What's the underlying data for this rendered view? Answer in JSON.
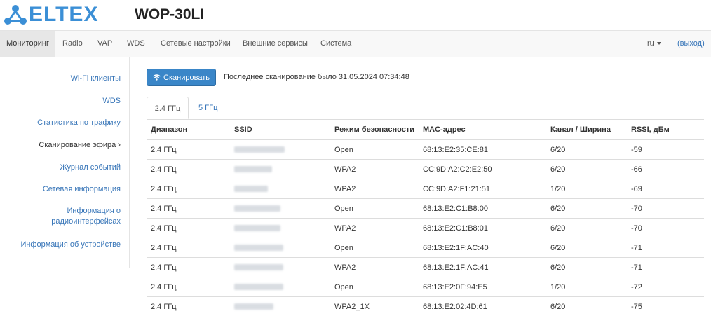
{
  "brand": {
    "logo_text": "ELTEX",
    "color": "#3b8fd6"
  },
  "device_model": "WOP-30LI",
  "nav": {
    "items": [
      "Мониторинг",
      "Radio",
      "VAP",
      "WDS",
      "Сетевые настройки",
      "Внешние сервисы",
      "Система"
    ],
    "active": "Мониторинг",
    "language": "ru",
    "logout": "(выход)"
  },
  "sidebar": {
    "items": [
      "Wi-Fi клиенты",
      "WDS",
      "Статистика по трафику",
      "Сканирование эфира",
      "Журнал событий",
      "Сетевая информация",
      "Информация о",
      "радиоинтерфейсах",
      "Информация об устройстве"
    ],
    "current": "Сканирование эфира",
    "current_marker": "›"
  },
  "scan": {
    "button_label": "Сканировать",
    "button_icon": "wifi-icon",
    "last_scan": "Последнее сканирование было 31.05.2024 07:34:48"
  },
  "tabs": [
    "2.4 ГГц",
    "5 ГГц"
  ],
  "active_tab": "2.4 ГГц",
  "table": {
    "headers": [
      "Диапазон",
      "SSID",
      "Режим безопасности",
      "MAC-адрес",
      "Канал / Ширина",
      "RSSI, дБм"
    ],
    "rows": [
      {
        "band": "2.4 ГГц",
        "security": "Open",
        "mac": "68:13:E2:35:CE:81",
        "channel": "6/20",
        "rssi": "-59"
      },
      {
        "band": "2.4 ГГц",
        "security": "WPA2",
        "mac": "CC:9D:A2:C2:E2:50",
        "channel": "6/20",
        "rssi": "-66"
      },
      {
        "band": "2.4 ГГц",
        "security": "WPA2",
        "mac": "CC:9D:A2:F1:21:51",
        "channel": "1/20",
        "rssi": "-69"
      },
      {
        "band": "2.4 ГГц",
        "security": "Open",
        "mac": "68:13:E2:C1:B8:00",
        "channel": "6/20",
        "rssi": "-70"
      },
      {
        "band": "2.4 ГГц",
        "security": "WPA2",
        "mac": "68:13:E2:C1:B8:01",
        "channel": "6/20",
        "rssi": "-70"
      },
      {
        "band": "2.4 ГГц",
        "security": "Open",
        "mac": "68:13:E2:1F:AC:40",
        "channel": "6/20",
        "rssi": "-71"
      },
      {
        "band": "2.4 ГГц",
        "security": "WPA2",
        "mac": "68:13:E2:1F:AC:41",
        "channel": "6/20",
        "rssi": "-71"
      },
      {
        "band": "2.4 ГГц",
        "security": "Open",
        "mac": "68:13:E2:0F:94:E5",
        "channel": "1/20",
        "rssi": "-72"
      },
      {
        "band": "2.4 ГГц",
        "security": "WPA2_1X",
        "mac": "68:13:E2:02:4D:61",
        "channel": "6/20",
        "rssi": "-75"
      }
    ]
  }
}
